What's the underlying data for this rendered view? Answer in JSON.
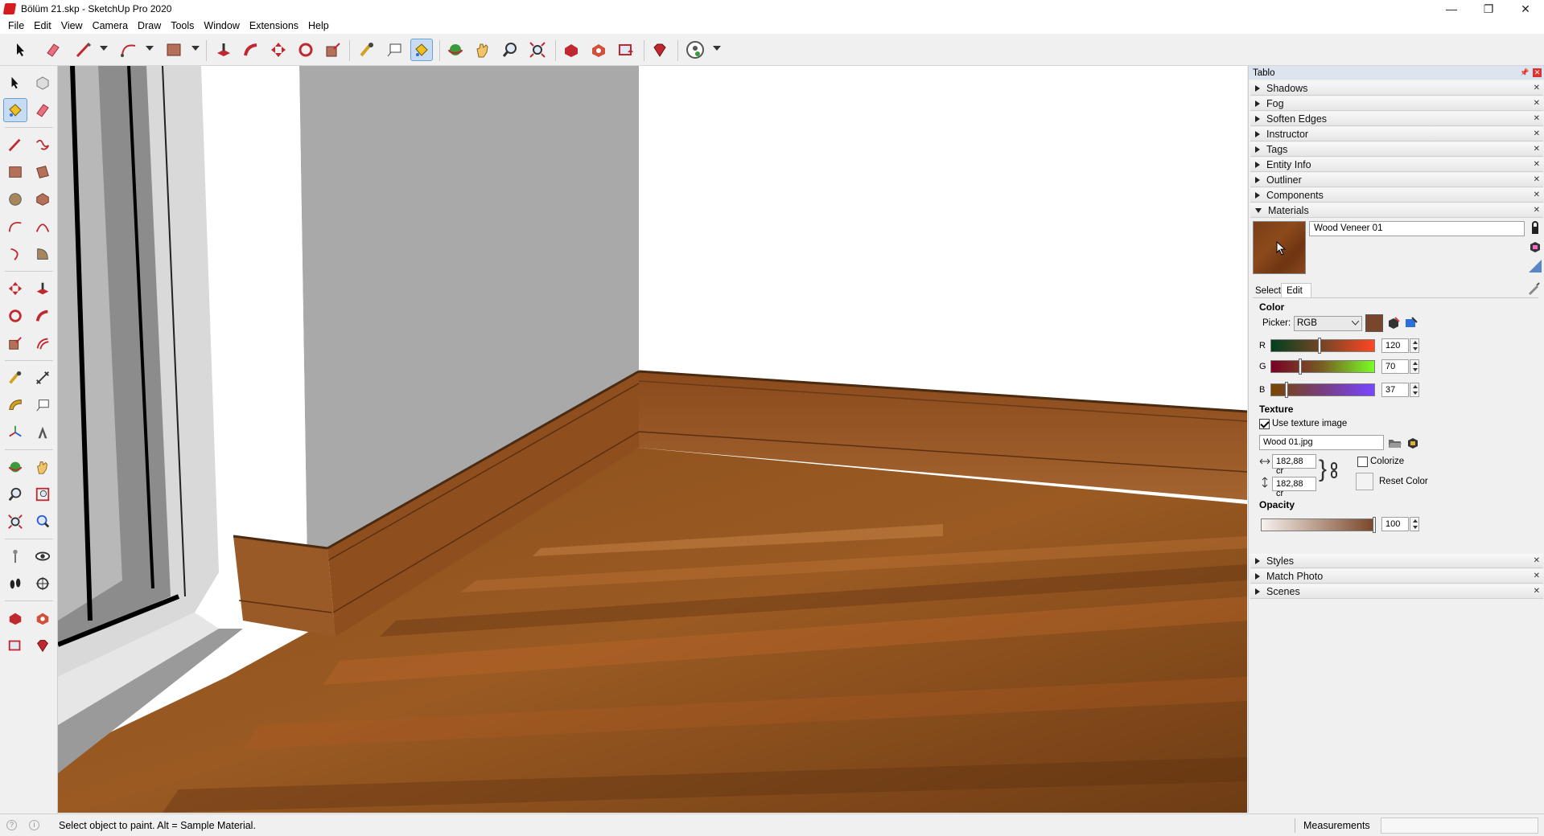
{
  "window": {
    "title": "Bölüm 21.skp - SketchUp Pro 2020",
    "minimize": "—",
    "maximize": "❐",
    "close": "✕"
  },
  "menu": [
    "File",
    "Edit",
    "View",
    "Camera",
    "Draw",
    "Tools",
    "Window",
    "Extensions",
    "Help"
  ],
  "tray": {
    "title": "Tablo",
    "panels_top": [
      "Shadows",
      "Fog",
      "Soften Edges",
      "Instructor",
      "Tags",
      "Entity Info",
      "Outliner",
      "Components",
      "Materials"
    ],
    "panels_bottom": [
      "Styles",
      "Match Photo",
      "Scenes"
    ]
  },
  "materials": {
    "name": "Wood Veneer 01",
    "swatch_color": "#7a3d16",
    "tabs": {
      "select": "Select",
      "edit": "Edit"
    },
    "color_section": "Color",
    "picker_label": "Picker:",
    "picker_value": "RGB",
    "r_label": "R",
    "r_value": "120",
    "g_label": "G",
    "g_value": "70",
    "b_label": "B",
    "b_value": "37",
    "texture_section": "Texture",
    "use_texture_label": "Use texture image",
    "use_texture_checked": true,
    "texture_file": "Wood 01.jpg",
    "width_value": "182,88 cr",
    "height_value": "182,88 cr",
    "colorize_label": "Colorize",
    "reset_color_label": "Reset Color",
    "opacity_section": "Opacity",
    "opacity_value": "100"
  },
  "status": {
    "message": "Select object to paint. Alt = Sample Material.",
    "measurements_label": "Measurements",
    "measurements_value": ""
  },
  "icons": [
    "select-icon",
    "eraser-icon",
    "line-icon",
    "arc-icon",
    "rectangle-icon",
    "push-pull-icon",
    "offset-icon",
    "move-icon",
    "rotate-icon",
    "scale-icon",
    "tape-measure-icon",
    "text-icon",
    "paint-bucket-icon",
    "orbit-icon",
    "pan-icon",
    "zoom-icon",
    "zoom-extents-icon",
    "warehouse-icon",
    "extension-warehouse-icon",
    "layout-icon",
    "ruby-icon",
    "profile-icon"
  ]
}
